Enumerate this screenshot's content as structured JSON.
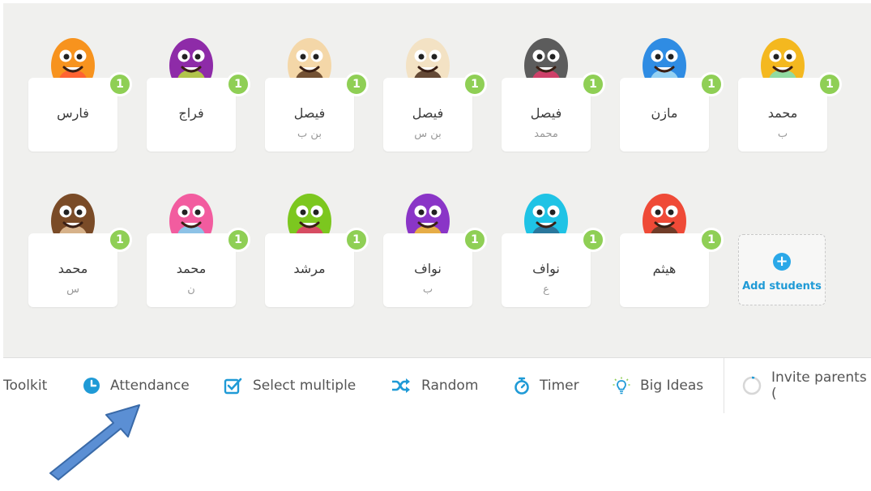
{
  "students": [
    {
      "first": "فارس",
      "last": "",
      "points": "1",
      "color": "#f7931e",
      "accent": "#ff5a36"
    },
    {
      "first": "فراج",
      "last": "",
      "points": "1",
      "color": "#8e2ba8",
      "accent": "#b7df3a"
    },
    {
      "first": "فيصل",
      "last": "بن ب",
      "points": "1",
      "color": "#f4d7a8",
      "accent": "#5c3a1e"
    },
    {
      "first": "فيصل",
      "last": "بن س",
      "points": "1",
      "color": "#f3e2c4",
      "accent": "#4a2e1c"
    },
    {
      "first": "فيصل",
      "last": "محمد",
      "points": "1",
      "color": "#5c5c5c",
      "accent": "#e23b6b"
    },
    {
      "first": "مازن",
      "last": "",
      "points": "1",
      "color": "#2f8ce3",
      "accent": "#a7ddf5"
    },
    {
      "first": "محمد",
      "last": "ب",
      "points": "1",
      "color": "#f4b81f",
      "accent": "#7fe0b9"
    },
    {
      "first": "محمد",
      "last": "س",
      "points": "1",
      "color": "#7a4b27",
      "accent": "#e8c49c"
    },
    {
      "first": "محمد",
      "last": "ن",
      "points": "1",
      "color": "#f25c9f",
      "accent": "#7bd3f2"
    },
    {
      "first": "مرشد",
      "last": "",
      "points": "1",
      "color": "#7cc71f",
      "accent": "#e7366f"
    },
    {
      "first": "نواف",
      "last": "ب",
      "points": "1",
      "color": "#8a35c7",
      "accent": "#f6c230"
    },
    {
      "first": "نواف",
      "last": "ع",
      "points": "1",
      "color": "#1fc3e5",
      "accent": "#2d6a8f"
    },
    {
      "first": "هيثم",
      "last": "",
      "points": "1",
      "color": "#ef4a37",
      "accent": "#5a3a26"
    }
  ],
  "add_students": {
    "label": "Add students",
    "icon": "plus-icon"
  },
  "toolbar": {
    "toolkit": "Toolkit",
    "attendance": "Attendance",
    "select_multiple": "Select multiple",
    "random": "Random",
    "timer": "Timer",
    "big_ideas": "Big Ideas",
    "invite_parents": "Invite parents ("
  },
  "colors": {
    "accent_blue": "#1f9ad6",
    "badge_green": "#8fcf55",
    "arrow_blue": "#5b8fd4"
  },
  "annotation": {
    "icon": "arrow-pointer-icon"
  }
}
